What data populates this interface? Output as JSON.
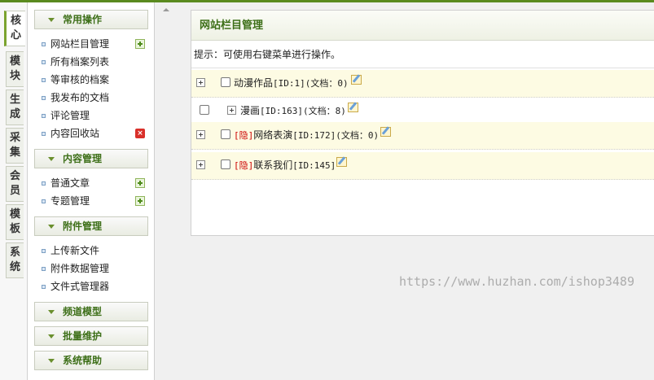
{
  "vertical_tabs": [
    "核心",
    "模块",
    "生成",
    "采集",
    "会员",
    "模板",
    "系统"
  ],
  "sidebar": {
    "groups": [
      {
        "title": "常用操作",
        "items": [
          {
            "label": "网站栏目管理",
            "icon": "add-icon"
          },
          {
            "label": "所有档案列表",
            "icon": ""
          },
          {
            "label": "等审核的档案",
            "icon": ""
          },
          {
            "label": "我发布的文档",
            "icon": ""
          },
          {
            "label": "评论管理",
            "icon": ""
          },
          {
            "label": "内容回收站",
            "icon": "delete-icon"
          }
        ]
      },
      {
        "title": "内容管理",
        "items": [
          {
            "label": "普通文章",
            "icon": "add-icon"
          },
          {
            "label": "专题管理",
            "icon": "add-icon"
          }
        ]
      },
      {
        "title": "附件管理",
        "items": [
          {
            "label": "上传新文件",
            "icon": ""
          },
          {
            "label": "附件数据管理",
            "icon": ""
          },
          {
            "label": "文件式管理器",
            "icon": ""
          }
        ]
      },
      {
        "title": "频道模型",
        "items": []
      },
      {
        "title": "批量维护",
        "items": []
      },
      {
        "title": "系统帮助",
        "items": []
      }
    ]
  },
  "main": {
    "title": "网站栏目管理",
    "hint": "提示：可使用右键菜单进行操作。",
    "rows": [
      {
        "hidden_tag": "",
        "name": "动漫作品",
        "meta": "[ID:1](文档：0)"
      },
      {
        "hidden_tag": "",
        "name": "漫画",
        "meta": "[ID:163](文档：8)"
      },
      {
        "hidden_tag": "[隐]",
        "name": "网络表演",
        "meta": "[ID:172](文档：0)"
      },
      {
        "hidden_tag": "[隐]",
        "name": "联系我们",
        "meta": "[ID:145]"
      }
    ]
  },
  "watermark": "https://www.huzhan.com/ishop3489",
  "colors": {
    "accent": "#3d6f18",
    "topline": "#5a8a1f",
    "hidden": "#cc0000",
    "row_highlight": "#fdfbe3"
  }
}
